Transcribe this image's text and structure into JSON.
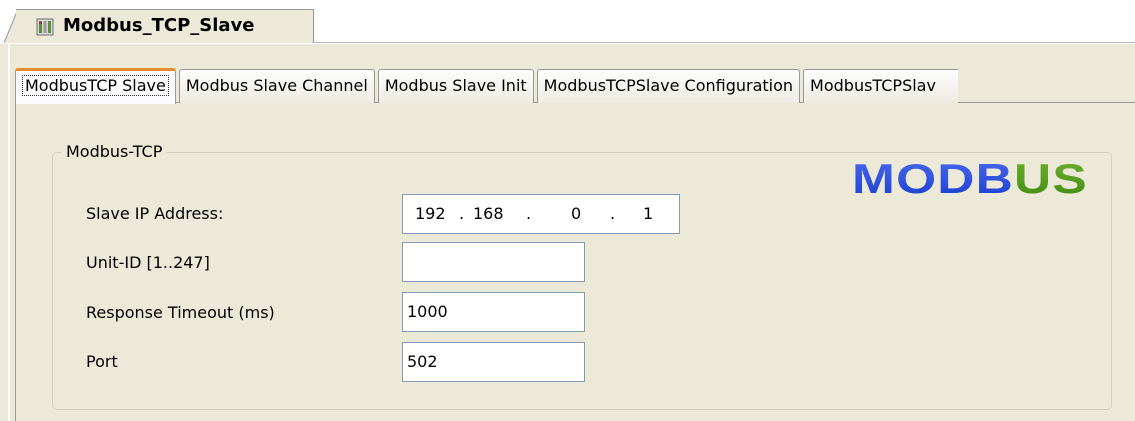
{
  "editor_tab": {
    "label": "Modbus_TCP_Slave",
    "icon": "device-icon"
  },
  "tabs": [
    {
      "label": "ModbusTCP Slave",
      "active": true
    },
    {
      "label": "Modbus Slave Channel",
      "active": false
    },
    {
      "label": "Modbus Slave Init",
      "active": false
    },
    {
      "label": "ModbusTCPSlave Configuration",
      "active": false
    },
    {
      "label": "ModbusTCPSlav",
      "active": false
    }
  ],
  "group": {
    "title": "Modbus-TCP"
  },
  "fields": {
    "slave_ip": {
      "label": "Slave IP Address:",
      "octets": [
        "192",
        "168",
        "0",
        "1"
      ],
      "separator": "."
    },
    "unit_id": {
      "label": "Unit-ID [1..247]",
      "value": ""
    },
    "response_timeout": {
      "label": "Response Timeout (ms)",
      "value": "1000"
    },
    "port": {
      "label": "Port",
      "value": "502"
    }
  },
  "logo": {
    "text": "MODBUS",
    "colors": {
      "blue": "#1a3ccf",
      "green": "#3f8a12"
    }
  },
  "colors": {
    "panel_background": "#ece9d8",
    "active_tab_accent": "#e68b2c",
    "input_border": "#7f9db9"
  }
}
